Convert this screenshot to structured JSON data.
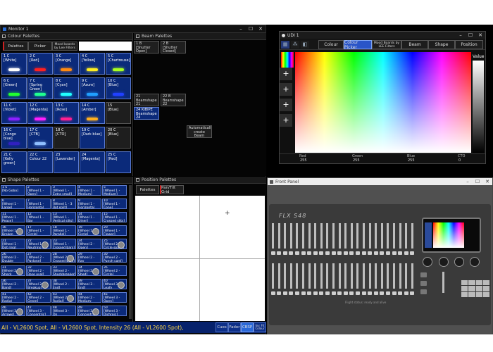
{
  "monitor": {
    "title": "Monitor 1",
    "window_buttons": [
      "–",
      "☐",
      "✕"
    ]
  },
  "colour_palettes": {
    "header": "Colour Palettes",
    "tabs": {
      "palettes": "Palettes",
      "picker": "Picker",
      "mood": "Mood boards by Lee Filters"
    },
    "items": [
      {
        "label": "1 C\n[White]",
        "color": "#ffffff"
      },
      {
        "label": "2 C\n[Red]",
        "color": "#ff2020"
      },
      {
        "label": "3 C\n[Orange]",
        "color": "#ff8a10"
      },
      {
        "label": "4 C\n[Yellow]",
        "color": "#ffee20"
      },
      {
        "label": "5 C\n[Chartreuse]",
        "color": "#a8ff20"
      },
      {
        "label": "6 C\n[Green]",
        "color": "#20ff30"
      },
      {
        "label": "7 C\n[Spring\nGreen]",
        "color": "#20ff90"
      },
      {
        "label": "8 C\n[Cyan]",
        "color": "#20ffff"
      },
      {
        "label": "9 C\n[Azure]",
        "color": "#20a0ff"
      },
      {
        "label": "10 C\n[Blue]",
        "color": "#2040ff"
      },
      {
        "label": "11 C\n[Violet]",
        "color": "#8a20ff"
      },
      {
        "label": "12 C\n[Magenta]",
        "color": "#ff20ff"
      },
      {
        "label": "13 C\n[Rose]",
        "color": "#ff2090"
      },
      {
        "label": "14 C\n[Amber]",
        "color": "#ffb020"
      },
      {
        "label": "15\n[Blue]",
        "color": ""
      },
      {
        "label": "16 C\n[Congo blue]",
        "color": "#3020c0"
      },
      {
        "label": "17 C\n[CTB]",
        "color": "#90c0ff"
      },
      {
        "label": "18 C\n[CTO]",
        "color": ""
      },
      {
        "label": "19 C\n[Dark blue]",
        "color": ""
      },
      {
        "label": "20 C\n[Blue]",
        "color": ""
      },
      {
        "label": "21 C\n[Kelly green]",
        "color": ""
      },
      {
        "label": "22 C\nColour 22",
        "color": ""
      },
      {
        "label": "23\n[Lavender]",
        "color": ""
      },
      {
        "label": "24\n[Magenta]",
        "color": ""
      },
      {
        "label": "25 C\n[Red]",
        "color": ""
      }
    ]
  },
  "beam_palettes": {
    "header": "Beam Palettes",
    "items": [
      {
        "label": "1 B\n[Shutter\nOpen]"
      },
      {
        "label": "2 B\n[Shutter\nClosed]"
      },
      {
        "label": "21\nBeamshape\n21"
      },
      {
        "label": "22 B\nBeamshape\n22"
      },
      {
        "label": "24 KIBIPE\nBeamshape\n24"
      }
    ],
    "auto_create": "Automatically\ncreate Beam\npalettes"
  },
  "shape_palettes": {
    "header": "Shape Palettes",
    "items": [
      "1 S\n[No Gobo]",
      "2\n[Wheel 1 -\nOpen]",
      "3\n[Wheel 1 -\nExtra small]",
      "4\n[Wheel 1 -\nMedium]",
      "5\n[Wheel 1 -\nMedium]",
      "6\n[Wheel 1 -\nLarge]",
      "7\n[Wheel 1 -\nHorizontal bar]",
      "8\n[Wheel 1 - 3\ndot split]",
      "9\n[Wheel 1 -\nHorizontal ellip]",
      "10\n[Wheel 1 -\nCone]",
      "11\n[Wheel 1 -\nPeace]",
      "12\n[Wheel 1 - Bar\nDrawn]",
      "13\n[Wheel 1 -\nVertical slits]",
      "14\n[Wheel 1 -\nDiner]",
      "15\n[Wheel 1 -\nCrossed slits]",
      "16\n[Wheel 1 -\nBroken\nTriangle]",
      "17\n[Wheel 1 -\nCircle]",
      "18\n[Wheel 1 -\nParallel]",
      "19\n[Wheel 1 -\nCircle]",
      "20\n[Wheel 1 -\nFlower]",
      "21\n[Wheel 1 -\nDot ring]",
      "22\n[Wheel 1 -\nNeutrino v2]",
      "23\n[Wheel 1 -\nCrossed bars]",
      "24\n[Wheel 2 -\nOpen]",
      "25\n[Wheel 2 -\nCircle space]",
      "26\n[Wheel 2 -\nDouble Shade]",
      "27\n[Wheel 2 -\nPaylone]",
      "28\n[Wheel 2 -\nCrossed bars]",
      "29\n[Wheel 2 - Ray\ngear]",
      "30\n[Wheel 2 -\nPunch card]",
      "31\n[Wheel 2 -\nShock breaker]",
      "32\n[Wheel 2 -\nRose oval]",
      "33\n[Wheel 2 -\nShockbreaker]",
      "34\n[Wheel 2 -\nShed]",
      "35\n[Wheel 2 -\nCircle]",
      "36\n[Wheel 2 -\nBand]",
      "37\n[Wheel 2 -\nBreakup]",
      "38\n[Wheel 2 -\nEnd]",
      "39\n[Wheel 3 -\nEnd]",
      "40\n[Wheel 3 - Leafy\nbreakup]",
      "41\n[Wheel 2 -\nRadial breakup]",
      "42\n[Wheel 2 -\nGreen]",
      "43\n[Wheel 2 -\nRadial]",
      "44\n[Wheel 2 -\nMedium-circle]",
      "45\n[Wheel 3 -\nOpen]",
      "46\n[Wheel 3 -\nArrows]",
      "47\n[Wheel 3 -\nConcentric]",
      "48\n[Wheel 3 - On\nthe rocks]",
      "49\n[Wheel 3 -\nConcentric]",
      "50\n[Wheel 3 -\nDichroic]"
    ]
  },
  "position_palettes": {
    "header": "Position Palettes",
    "tabs": {
      "palettes": "Palettes",
      "pantilt": "Pan/Tilt Grid"
    },
    "crosshair": "+"
  },
  "status": {
    "text": "All - VL2600 Spot, All - VL2600 Spot, Intensity 26 (All - VL2600 Spot),",
    "buttons": [
      "Cues",
      "Fader",
      "CBSP",
      "Inv. Fit\nColour"
    ]
  },
  "picker_window": {
    "title": "UDI 1",
    "tabs": [
      "Colour",
      "Colour Picker",
      "Mood Boards by LEE Filters",
      "Beam",
      "Shape",
      "Position"
    ],
    "value_label": "Value",
    "plus": [
      "+",
      "+",
      "+",
      "+"
    ],
    "readouts": [
      {
        "label": "Red",
        "value": "255"
      },
      {
        "label": "Green",
        "value": "255"
      },
      {
        "label": "Blue",
        "value": "255"
      },
      {
        "label": "CTO",
        "value": "0"
      }
    ]
  },
  "front_panel": {
    "title": "Front Panel",
    "brand": "FLX S48",
    "footer": "Flight status: ready and alive"
  }
}
